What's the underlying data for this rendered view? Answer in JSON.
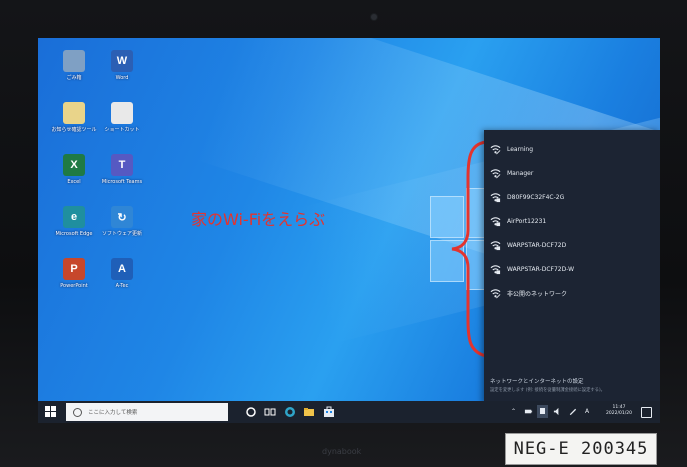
{
  "desktop": {
    "icons": [
      {
        "label": "ごみ箱",
        "symbol": "",
        "color": "#7fa0c4",
        "icon": "recycle-bin-icon"
      },
      {
        "label": "Word",
        "symbol": "W",
        "color": "#2b5fb4",
        "icon": "word-icon"
      },
      {
        "label": "お知らせ確認ツール",
        "symbol": "",
        "color": "#e9d48a",
        "icon": "folder-icon"
      },
      {
        "label": "ショートカット",
        "symbol": "",
        "color": "#e9e9e9",
        "icon": "document-icon"
      },
      {
        "label": "Excel",
        "symbol": "X",
        "color": "#1f7a45",
        "icon": "excel-icon"
      },
      {
        "label": "Microsoft Teams",
        "symbol": "T",
        "color": "#5659c2",
        "icon": "teams-icon"
      },
      {
        "label": "Microsoft Edge",
        "symbol": "e",
        "color": "#1f8f9f",
        "icon": "edge-icon"
      },
      {
        "label": "ソフトウェア更新",
        "symbol": "↻",
        "color": "#2f86d6",
        "icon": "update-icon"
      },
      {
        "label": "PowerPoint",
        "symbol": "P",
        "color": "#c7472b",
        "icon": "powerpoint-icon"
      },
      {
        "label": "A-Tec",
        "symbol": "A",
        "color": "#1f5fb8",
        "icon": "app-icon"
      }
    ]
  },
  "annotation": {
    "text": "家のWi-Fiをえらぶ",
    "color": "#e3342f"
  },
  "wifi_panel": {
    "networks": [
      {
        "name": "Learning",
        "secured": false
      },
      {
        "name": "Manager",
        "secured": false
      },
      {
        "name": "D80F99C32F4C-2G",
        "secured": true
      },
      {
        "name": "AirPort12231",
        "secured": true
      },
      {
        "name": "WARPSTAR-DCF72D",
        "secured": true
      },
      {
        "name": "WARPSTAR-DCF72D-W",
        "secured": true
      },
      {
        "name": "非公開のネットワーク",
        "secured": false
      }
    ],
    "settings_title": "ネットワークとインターネットの設定",
    "settings_sub": "設定を変更します (例: 接続を従量制課金接続に設定する)。"
  },
  "taskbar": {
    "search_placeholder": "ここに入力して検索",
    "ime_label": "A",
    "time": "11:47",
    "date": "2022/01/20"
  },
  "device": {
    "brand": "dynabook",
    "asset_tag": "NEG-E 200345"
  }
}
